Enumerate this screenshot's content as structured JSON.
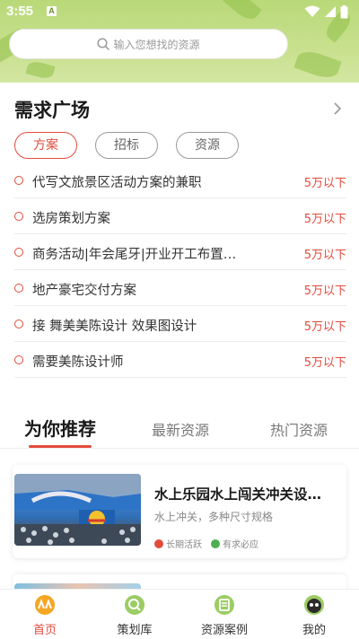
{
  "status_bar": {
    "time": "3:55",
    "notification_icon": "A"
  },
  "search": {
    "placeholder": "输入您想找的资源"
  },
  "demand_square": {
    "title": "需求广场",
    "filters": [
      {
        "label": "方案",
        "active": true
      },
      {
        "label": "招标",
        "active": false
      },
      {
        "label": "资源",
        "active": false
      }
    ],
    "items": [
      {
        "title": "代写文旅景区活动方案的兼职",
        "budget": "5万以下"
      },
      {
        "title": "选房策划方案",
        "budget": "5万以下"
      },
      {
        "title": "商务活动|年会尾牙|开业开工布置…",
        "budget": "5万以下"
      },
      {
        "title": "地产豪宅交付方案",
        "budget": "5万以下"
      },
      {
        "title": "接 舞美美陈设计 效果图设计",
        "budget": "5万以下"
      },
      {
        "title": "需要美陈设计师",
        "budget": "5万以下"
      }
    ]
  },
  "recommend_tabs": [
    {
      "label": "为你推荐",
      "active": true
    },
    {
      "label": "最新资源",
      "active": false
    },
    {
      "label": "热门资源",
      "active": false
    }
  ],
  "cards": [
    {
      "title": "水上乐园水上闯关冲关设…",
      "subtitle": "水上冲关，多种尺寸规格",
      "tags": [
        "长期活跃",
        "有求必应"
      ]
    }
  ],
  "bottom_nav": [
    {
      "label": "首页",
      "icon": "home-icon",
      "active": true
    },
    {
      "label": "策划库",
      "icon": "planning-library-icon",
      "active": false
    },
    {
      "label": "资源案例",
      "icon": "resource-cases-icon",
      "active": false
    },
    {
      "label": "我的",
      "icon": "profile-icon",
      "active": false
    }
  ],
  "colors": {
    "accent": "#e24b3c",
    "hero_green": "#c7e08c"
  }
}
